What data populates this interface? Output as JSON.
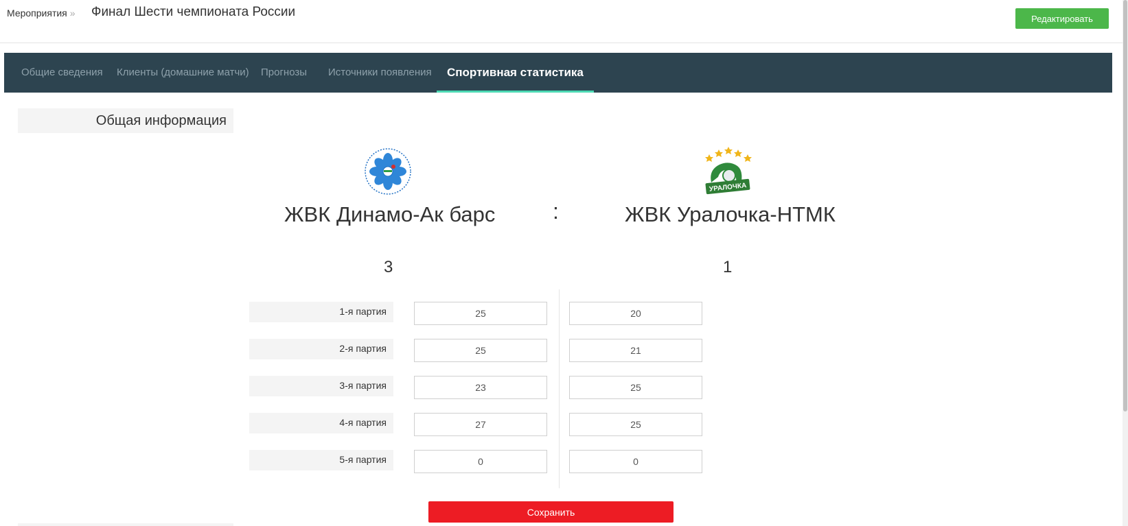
{
  "header": {
    "breadcrumb": "Мероприятия",
    "breadcrumb_separator": "»",
    "title": "Финал Шести чемпионата России",
    "edit_label": "Редактировать"
  },
  "tabs": [
    {
      "label": "Общие сведения",
      "active": false
    },
    {
      "label": "Клиенты (домашние матчи)",
      "active": false
    },
    {
      "label": "Прогнозы",
      "active": false
    },
    {
      "label": "Источники появления",
      "active": false
    },
    {
      "label": "Спортивная статистика",
      "active": true
    }
  ],
  "section": {
    "title": "Общая информация"
  },
  "match": {
    "home": {
      "name": "ЖВК Динамо-Ак барс",
      "score": "3",
      "logo": "dinamo-kazan-logo"
    },
    "separator": ":",
    "away": {
      "name": "ЖВК Уралочка-НТМК",
      "score": "1",
      "logo": "uralochka-logo"
    },
    "sets": [
      {
        "label": "1-я партия",
        "home": "25",
        "away": "20"
      },
      {
        "label": "2-я партия",
        "home": "25",
        "away": "21"
      },
      {
        "label": "3-я партия",
        "home": "23",
        "away": "25"
      },
      {
        "label": "4-я партия",
        "home": "27",
        "away": "25"
      },
      {
        "label": "5-я партия",
        "home": "0",
        "away": "0"
      }
    ]
  },
  "save_label": "Сохранить",
  "colors": {
    "tabbar": "#2d4450",
    "tab_active_underline": "#4dd9b4",
    "edit_button": "#4cb74a",
    "save_button": "#ed1c24"
  }
}
